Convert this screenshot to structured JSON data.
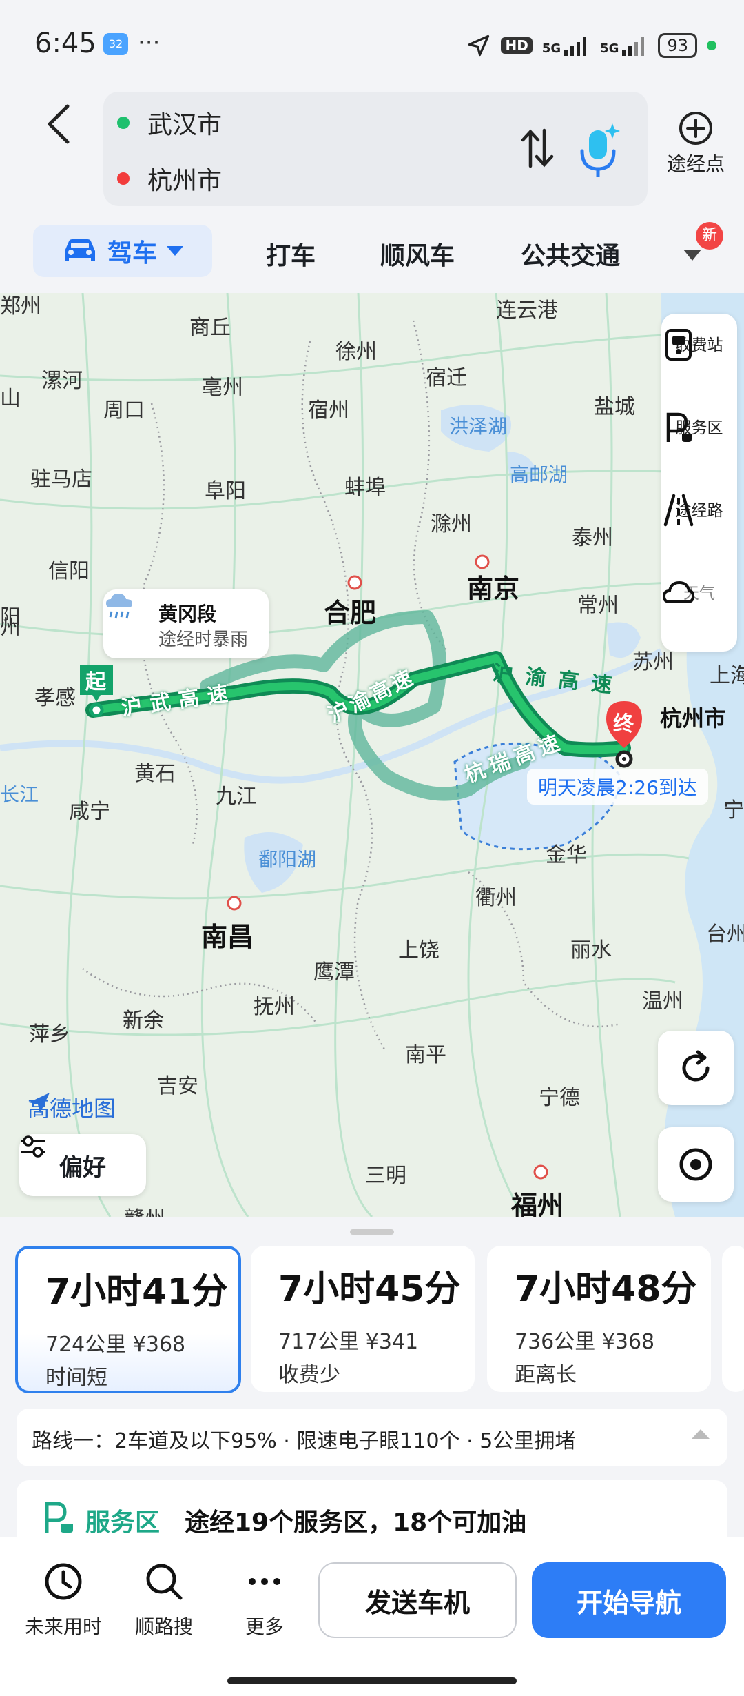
{
  "status": {
    "time": "6:45",
    "weather_temp": "32",
    "battery": "93",
    "net1": "HD",
    "net2": "5G",
    "net3": "5G"
  },
  "header": {
    "origin": "武汉市",
    "destination": "杭州市",
    "waypoint_label": "途经点",
    "colors": {
      "origin_dot": "#1fc06e",
      "dest_dot": "#f23c3c"
    }
  },
  "modes": {
    "drive": "驾车",
    "taxi": "打车",
    "carpool": "顺风车",
    "transit": "公共交通",
    "new_badge": "新"
  },
  "map": {
    "cities": {
      "zhengzhou": "郑州",
      "shangqiu": "商丘",
      "lianyungang": "连云港",
      "xuzhou": "徐州",
      "suqian": "宿迁",
      "luohe": "漯河",
      "bozhou": "亳州",
      "zhoukou": "周口",
      "suzhou_ah": "宿州",
      "yancheng": "盐城",
      "hongzehu": "洪泽湖",
      "gaoyouhu": "高邮湖",
      "zhumadian": "驻马店",
      "fuyang": "阜阳",
      "bengbu": "蚌埠",
      "chuzhou": "滁州",
      "taizhou_js": "泰州",
      "xinyang": "信阳",
      "hefei": "合肥",
      "nanjing": "南京",
      "changzhou": "常州",
      "suzhou": "苏州",
      "shanghai": "上海",
      "xiaogan": "孝感",
      "huangshi": "黄石",
      "jiujiang": "九江",
      "xianning": "咸宁",
      "changjiang": "长江",
      "poyanghu": "鄱阳湖",
      "jinhua": "金华",
      "quzhou": "衢州",
      "nanchang": "南昌",
      "shangrao": "上饶",
      "lishui": "丽水",
      "yingtan": "鹰潭",
      "taizhou_zj": "台州",
      "fuzhou_jx": "抚州",
      "wenzhou": "温州",
      "xinyu": "新余",
      "pingxiang": "萍乡",
      "jian": "吉安",
      "nanping": "南平",
      "ningde": "宁德",
      "sanming": "三明",
      "fuzhou": "福州",
      "ganzhou": "赣州",
      "hangzhou": "杭州市",
      "nanyang_edge": "阳",
      "zhenjiang_edge": "州",
      "ningbo_edge": "宁",
      "shan_edge": "山"
    },
    "roads": {
      "huwu": "沪武高速",
      "huyu": "沪渝高速",
      "huyu2": "沪渝高速",
      "hangrui": "杭瑞高速"
    },
    "start_pin": "起",
    "end_pin": "终",
    "weather_bubble": {
      "title": "黄冈段",
      "sub": "途经时暴雨"
    },
    "arrival": "明天凌晨2:26到达",
    "tools": {
      "toll": "收费站",
      "service": "服务区",
      "via_road": "途经路",
      "weather": "天气"
    },
    "logo": "高德地图",
    "preference": "偏好"
  },
  "routes": [
    {
      "duration": "7小时41分",
      "meta": "724公里 ¥368",
      "tag": "时间短"
    },
    {
      "duration": "7小时45分",
      "meta": "717公里 ¥341",
      "tag": "收费少"
    },
    {
      "duration": "7小时48分",
      "meta": "736公里 ¥368",
      "tag": "距离长"
    }
  ],
  "route_info": "路线一：2车道及以下95% · 限速电子眼110个 · 5公里拥堵",
  "service": {
    "title": "服务区",
    "desc": "途经19个服务区，18个可加油"
  },
  "actions": {
    "future": "未来用时",
    "along": "顺路搜",
    "more": "更多",
    "send": "发送车机",
    "navigate": "开始导航"
  }
}
